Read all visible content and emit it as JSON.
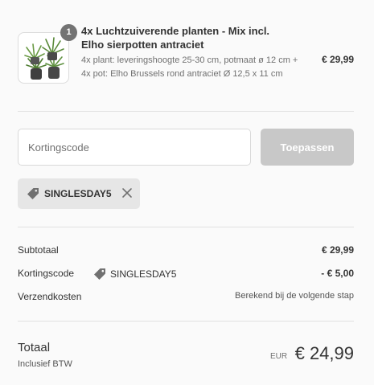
{
  "product": {
    "quantity": "1",
    "title": "4x Luchtzuiverende planten - Mix incl. Elho sierpotten antraciet",
    "description": "4x plant: leveringshoogte 25-30 cm, potmaat ø 12 cm + 4x pot: Elho Brussels rond antraciet Ø 12,5 x 11 cm",
    "price": "€ 29,99",
    "image_icon": "plant-icon"
  },
  "discount": {
    "placeholder": "Kortingscode",
    "value": "",
    "apply_label": "Toepassen",
    "applied_code": "SINGLESDAY5",
    "tag_icon": "tag-icon",
    "remove_icon": "close-icon"
  },
  "summary": {
    "subtotal_label": "Subtotaal",
    "subtotal_value": "€ 29,99",
    "discount_label": "Kortingscode",
    "discount_code": "SINGLESDAY5",
    "discount_value": "- € 5,00",
    "shipping_label": "Verzendkosten",
    "shipping_value": "Berekend bij de volgende stap"
  },
  "total": {
    "label": "Totaal",
    "sub_label": "Inclusief BTW",
    "currency": "EUR",
    "amount": "€ 24,99"
  },
  "colors": {
    "background": "#fafafa",
    "badge": "#737373",
    "button_disabled": "#c8c8c8",
    "chip": "#e6e6e6",
    "text": "#333333"
  }
}
